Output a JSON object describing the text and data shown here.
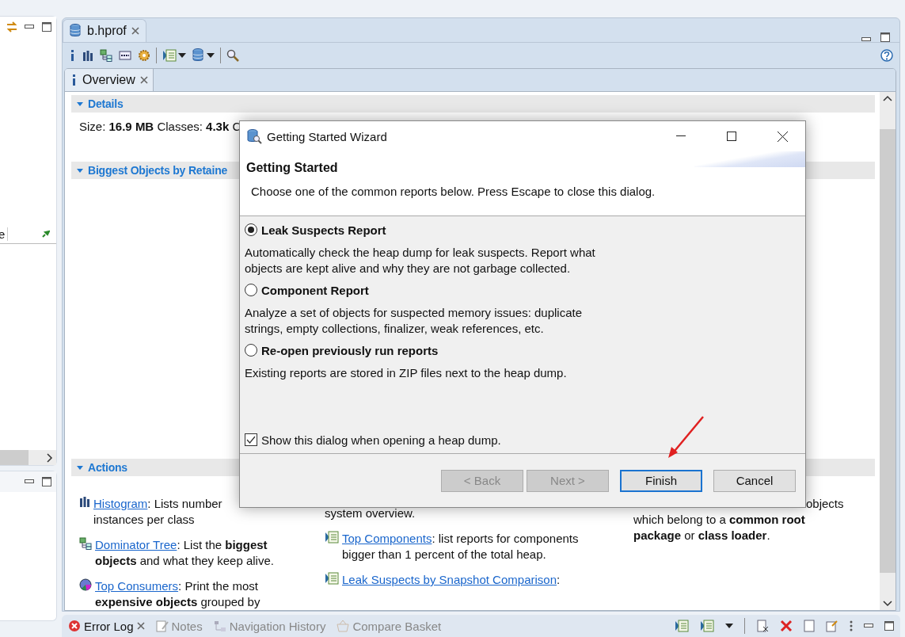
{
  "left_view": {
    "column_1": "e"
  },
  "editor": {
    "title": "b.hprof",
    "view_tab": "Overview"
  },
  "sections": [
    {
      "kind": "details",
      "title": "Details",
      "expanded": true,
      "text": "Size: **16.9 MB** Classes: **4.3k** C"
    },
    {
      "kind": "chart",
      "title": "Biggest Objects by Retaine",
      "expanded": true
    },
    {
      "kind": "actions",
      "title": "Actions",
      "expanded": true,
      "columns": [
        [
          {
            "kind": "histogram",
            "link": "Histogram",
            "text": ": Lists number\ninstances per class"
          },
          {
            "kind": "tree",
            "link": "Dominator Tree",
            "text": ": List the **biggest objects** and what they keep alive."
          },
          {
            "kind": "consumers",
            "link": "Top Consumers",
            "text": ": Print the most **expensive objects** grouped by"
          }
        ],
        [
          {
            "kind": "text",
            "text": "system overview."
          },
          {
            "kind": "report",
            "link": "Top Components",
            "text": ": list reports for components bigger than 1 percent of the total heap."
          },
          {
            "kind": "report",
            "link": "Leak Suspects by Snapshot Comparison",
            "text": ":"
          }
        ],
        [
          {
            "kind": "text",
            "text": "objects\nwhich belong to a **common root package** or **class loader**."
          }
        ]
      ]
    }
  ],
  "dialog": {
    "title": "Getting Started Wizard",
    "heading": "Getting Started",
    "description": "Choose one of the common reports below. Press Escape to close this dialog.",
    "options": [
      {
        "label": "Leak Suspects Report",
        "description": "Automatically check the heap dump for leak suspects. Report what objects are kept alive and why they are not garbage collected.",
        "selected": true
      },
      {
        "label": "Component Report",
        "description": "Analyze a set of objects for suspected memory issues: duplicate strings, empty collections, finalizer, weak references, etc.",
        "selected": false
      },
      {
        "label": "Re-open previously run reports",
        "description": "Existing reports are stored in ZIP files next to the heap dump.",
        "selected": false
      }
    ],
    "checkbox": {
      "label": "Show this dialog when opening a heap dump.",
      "checked": true
    },
    "buttons": [
      {
        "label": "< Back",
        "disabled": true,
        "default": false
      },
      {
        "label": "Next >",
        "disabled": true,
        "default": false
      },
      {
        "label": "Finish",
        "disabled": false,
        "default": true
      },
      {
        "label": "Cancel",
        "disabled": false,
        "default": false
      }
    ]
  },
  "bottom_tabs": [
    {
      "label": "Error Log",
      "selected": true
    },
    {
      "label": "Notes",
      "selected": false
    },
    {
      "label": "Navigation History",
      "selected": false
    },
    {
      "label": "Compare Basket",
      "selected": false
    }
  ]
}
